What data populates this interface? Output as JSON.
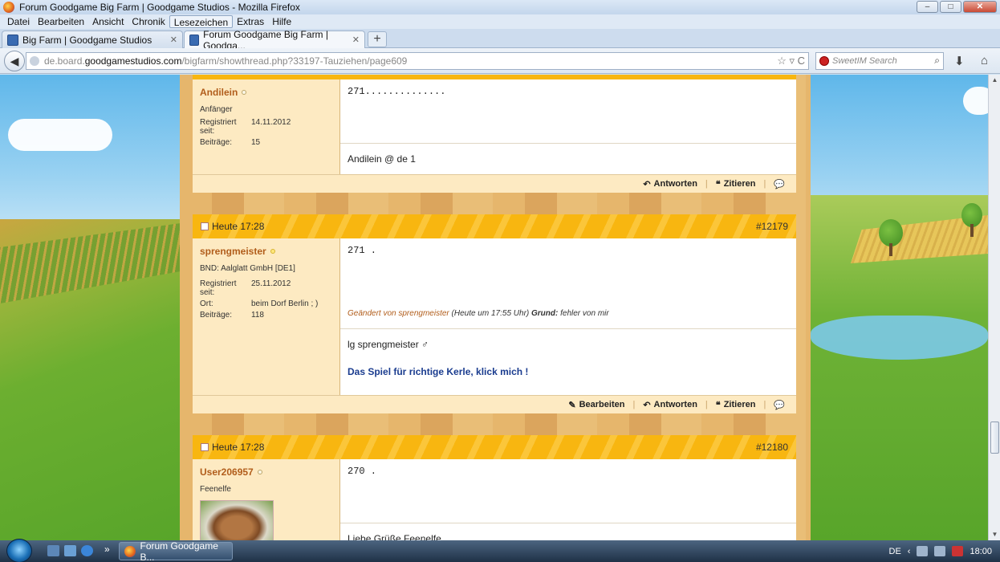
{
  "window": {
    "title": "Forum Goodgame Big Farm | Goodgame Studios - Mozilla Firefox",
    "min": "–",
    "max": "□",
    "close": "✕"
  },
  "menu": [
    "Datei",
    "Bearbeiten",
    "Ansicht",
    "Chronik",
    "Lesezeichen",
    "Extras",
    "Hilfe"
  ],
  "tabs": [
    {
      "label": "Big Farm | Goodgame Studios",
      "close": "✕"
    },
    {
      "label": "Forum Goodgame Big Farm | Goodga...",
      "close": "✕"
    }
  ],
  "new_tab": "+",
  "nav": {
    "back": "◀",
    "url_pre": "de.board.",
    "url_host": "goodgamestudios.com",
    "url_path": "/bigfarm/showthread.php?33197-Tauziehen/page609",
    "url_icons": "☆ ▿ C",
    "search_placeholder": "SweetIM Search",
    "search_btn": "⌕",
    "download": "⬇",
    "home": "⌂"
  },
  "posts": [
    {
      "username": "Andilein",
      "online": false,
      "title": "Anfänger",
      "rows": [
        {
          "k": "Registriert seit:",
          "v": "14.11.2012"
        },
        {
          "k": "Beiträge:",
          "v": "15"
        }
      ],
      "message": "271..............",
      "signature": "Andilein @ de 1",
      "footer": [
        "Antworten",
        "Zitieren"
      ]
    },
    {
      "date": "Heute 17:28",
      "number": "#12179",
      "username": "sprengmeister",
      "online": true,
      "title": "BND: Aalglatt GmbH [DE1]",
      "rows": [
        {
          "k": "Registriert seit:",
          "v": "25.11.2012"
        },
        {
          "k": "Ort:",
          "v": "beim Dorf Berlin ; )"
        },
        {
          "k": "Beiträge:",
          "v": "118"
        }
      ],
      "message": "271 .",
      "edited_by": "Geändert von sprengmeister",
      "edited_time": "(Heute um 17:55 Uhr)",
      "edited_reason_label": "Grund:",
      "edited_reason": "fehler von mir",
      "signature": "lg sprengmeister ♂",
      "signature_link": "Das Spiel für richtige Kerle, klick mich !",
      "footer": [
        "Bearbeiten",
        "Antworten",
        "Zitieren"
      ]
    },
    {
      "date": "Heute 17:28",
      "number": "#12180",
      "username": "User206957",
      "online": false,
      "title": "Feenelfe",
      "message": "270 .",
      "signature": "Liebe Grüße Feenelfe"
    }
  ],
  "taskbar": {
    "task": "Forum Goodgame B...",
    "lang": "DE",
    "time": "18:00",
    "chevrons": "»",
    "tray_arrow": "‹"
  }
}
